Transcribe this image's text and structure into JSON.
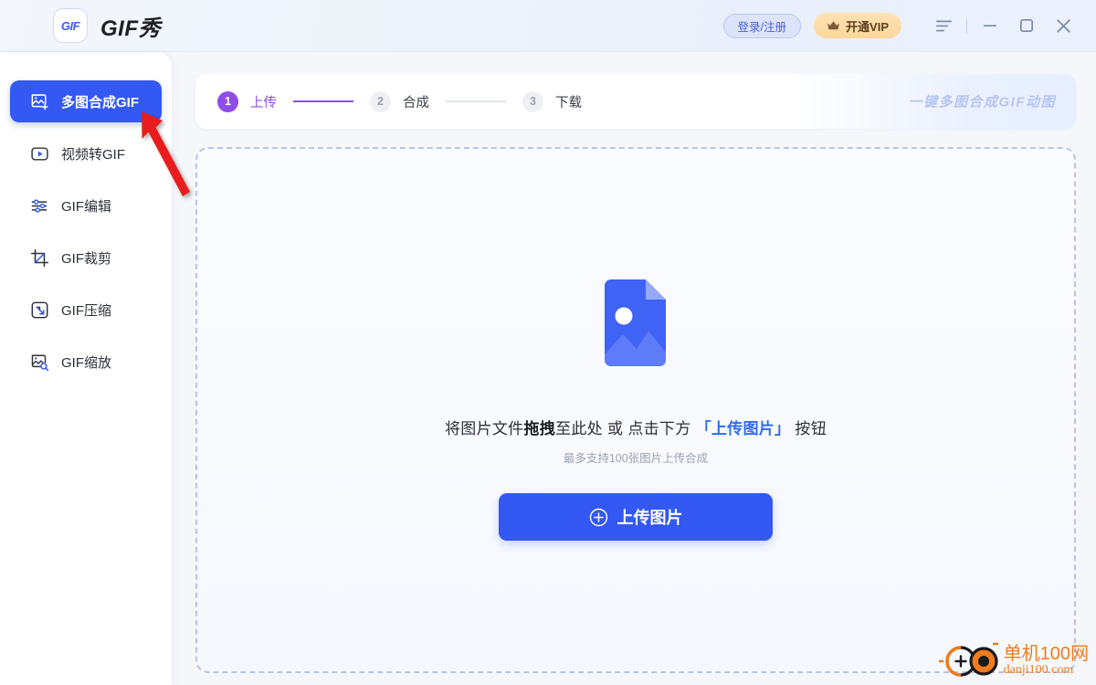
{
  "titlebar": {
    "logo_mark": "GIF",
    "app_title": "GIF秀",
    "login_label": "登录/注册",
    "vip_label": "开通VIP",
    "icons": {
      "menu": "hamburger-menu-icon",
      "minimize": "minimize-icon",
      "maximize": "maximize-icon",
      "close": "close-icon"
    }
  },
  "sidebar": {
    "items": [
      {
        "label": "多图合成GIF",
        "icon": "image-plus-icon",
        "active": true
      },
      {
        "label": "视频转GIF",
        "icon": "video-play-icon",
        "active": false
      },
      {
        "label": "GIF编辑",
        "icon": "sliders-icon",
        "active": false
      },
      {
        "label": "GIF裁剪",
        "icon": "crop-icon",
        "active": false
      },
      {
        "label": "GIF压缩",
        "icon": "compress-arrow-icon",
        "active": false
      },
      {
        "label": "GIF缩放",
        "icon": "image-zoom-icon",
        "active": false
      }
    ]
  },
  "steps": {
    "items": [
      {
        "num": "1",
        "label": "上传",
        "active": true
      },
      {
        "num": "2",
        "label": "合成",
        "active": false
      },
      {
        "num": "3",
        "label": "下载",
        "active": false
      }
    ],
    "banner": "一键多图合成GIF动图"
  },
  "dropzone": {
    "icon": "image-file-placeholder-icon",
    "main_prefix": "将图片文件",
    "main_bold": "拖拽",
    "main_middle": "至此处 或 点击下方",
    "main_highlight": "「上传图片」",
    "main_suffix": "按钮",
    "sub": "最多支持100张图片上传合成",
    "upload_button": "上传图片",
    "upload_icon": "plus-circle-icon"
  },
  "annotation": {
    "arrow": "red-arrow-pointer",
    "color": "#e81d1d"
  },
  "watermark": {
    "cn": "单机100网",
    "en": "danji100.com",
    "color": "#f07c1e"
  },
  "colors": {
    "primary_blue": "#3358f4",
    "step_purple": "#8f4de8",
    "vip_orange": "#fcd79a",
    "link_blue": "#2f6bf7"
  }
}
